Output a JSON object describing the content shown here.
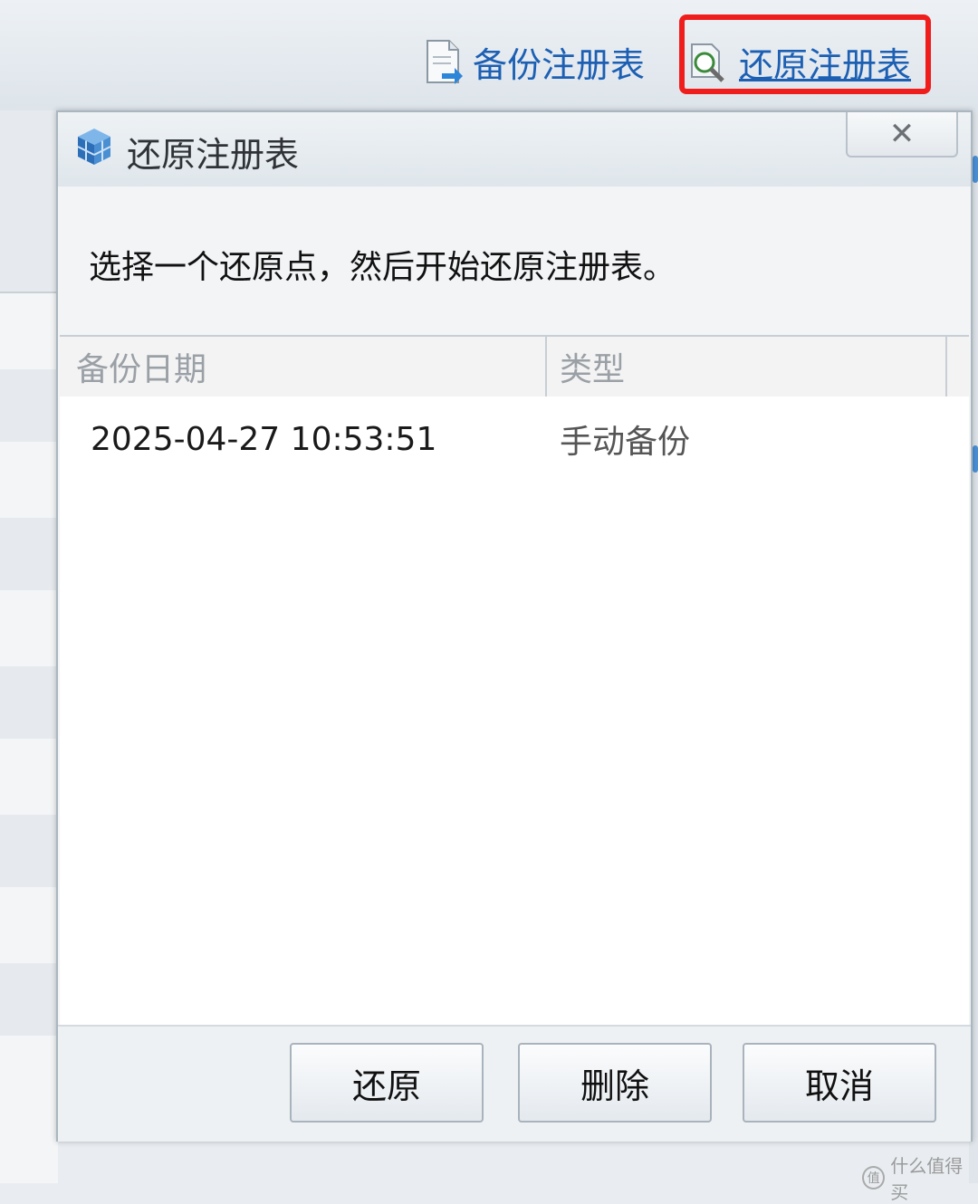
{
  "toolbar": {
    "backup_label": "备份注册表",
    "restore_label": "还原注册表"
  },
  "dialog": {
    "title": "还原注册表",
    "close_glyph": "✕",
    "prompt": "选择一个还原点，然后开始还原注册表。",
    "columns": [
      "备份日期",
      "类型"
    ],
    "rows": [
      {
        "date": "2025-04-27 10:53:51",
        "type": "手动备份"
      }
    ],
    "buttons": {
      "restore": "还原",
      "delete": "删除",
      "cancel": "取消"
    }
  },
  "highlight_color": "#f01d1d",
  "link_color": "#1c5fb3",
  "watermark": {
    "icon_glyph": "值",
    "text": "什么值得买"
  }
}
